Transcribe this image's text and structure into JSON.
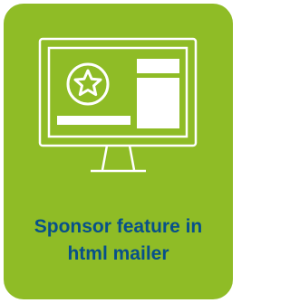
{
  "card": {
    "background_color": "#8fbc26",
    "text_color": "#07508a",
    "icon": "desktop-monitor-with-star-badge-icon",
    "caption_lines": [
      "Sponsor feature in",
      "html mailer"
    ]
  }
}
